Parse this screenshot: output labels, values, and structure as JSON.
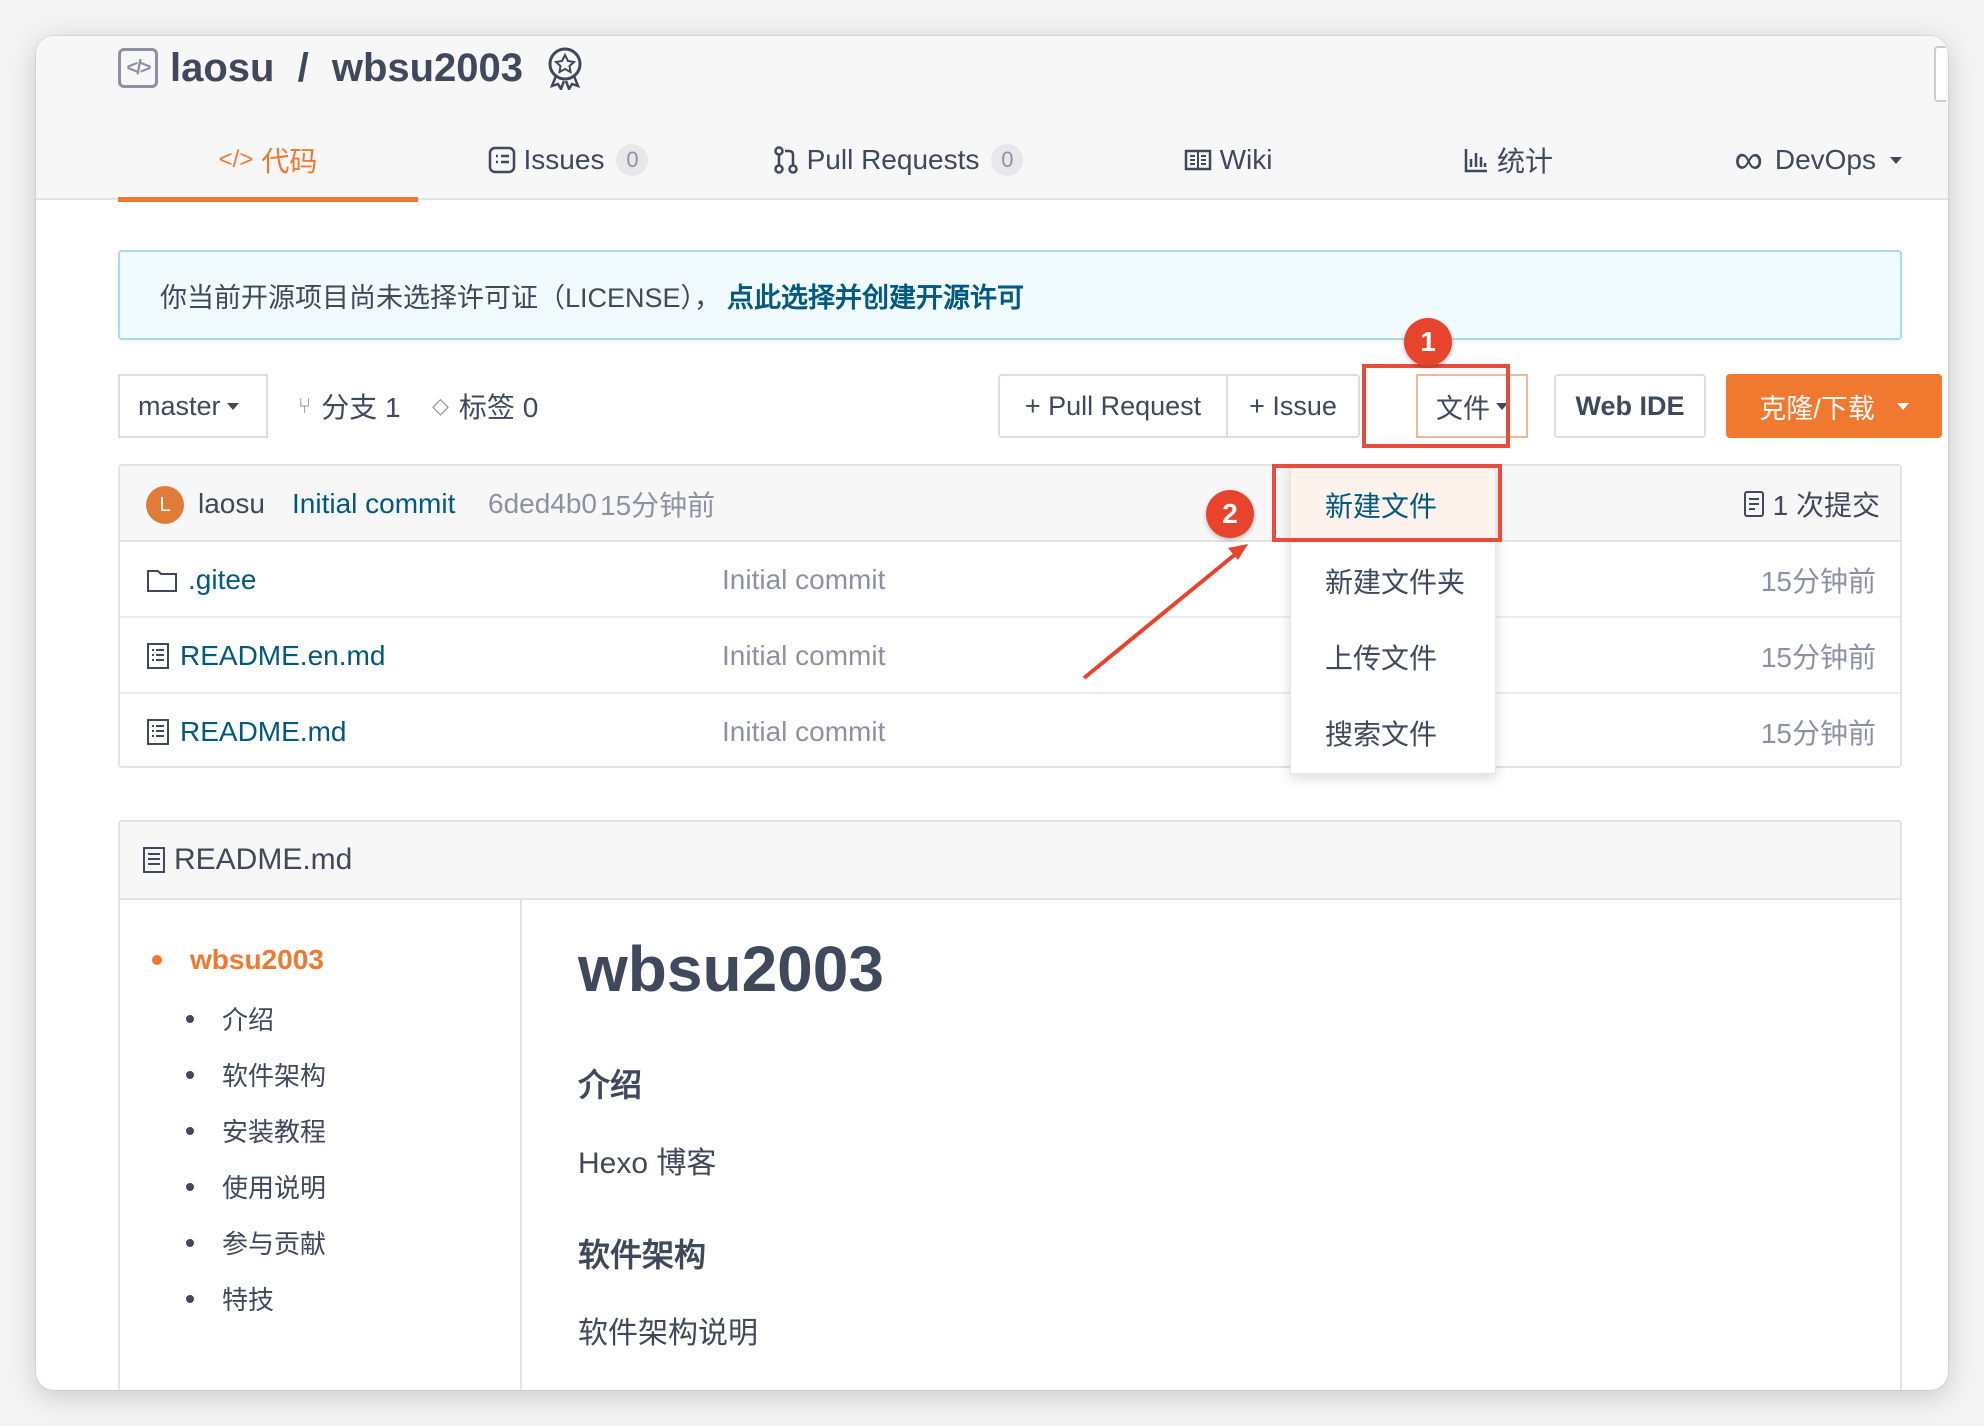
{
  "repo": {
    "owner": "laosu",
    "separator": " / ",
    "name": "wbsu2003"
  },
  "tabs": [
    {
      "label": "代码",
      "icon": "code-icon"
    },
    {
      "label": "Issues",
      "count": "0",
      "icon": "issue-icon"
    },
    {
      "label": "Pull Requests",
      "count": "0",
      "icon": "pull-request-icon"
    },
    {
      "label": "Wiki",
      "icon": "book-icon"
    },
    {
      "label": "统计",
      "icon": "bar-chart-icon"
    },
    {
      "label": "DevOps",
      "icon": "infinity-icon"
    }
  ],
  "notice": {
    "text": "你当前开源项目尚未选择许可证（LICENSE），",
    "link": "点此选择并创建开源许可"
  },
  "toolbar": {
    "branch": "master",
    "branches_label": "分支 1",
    "tags_label": "标签 0",
    "pull_request": "+ Pull Request",
    "issue": "+ Issue",
    "file": "文件",
    "web_ide": "Web IDE",
    "clone": "克隆/下载"
  },
  "commit": {
    "avatar_letter": "L",
    "author": "laosu",
    "message": "Initial commit",
    "hash": "6ded4b0",
    "time": "15分钟前",
    "count_label": "1 次提交"
  },
  "files": [
    {
      "name": ".gitee",
      "type": "folder",
      "message": "Initial commit",
      "time": "15分钟前"
    },
    {
      "name": "README.en.md",
      "type": "file",
      "message": "Initial commit",
      "time": "15分钟前"
    },
    {
      "name": "README.md",
      "type": "file",
      "message": "Initial commit",
      "time": "15分钟前"
    }
  ],
  "file_menu": [
    "新建文件",
    "新建文件夹",
    "上传文件",
    "搜索文件"
  ],
  "annotations": [
    "1",
    "2"
  ],
  "readme": {
    "filename": "README.md",
    "toc_main": "wbsu2003",
    "toc_items": [
      "介绍",
      "软件架构",
      "安装教程",
      "使用说明",
      "参与贡献",
      "特技"
    ],
    "title": "wbsu2003",
    "intro_heading": "介绍",
    "intro_text": "Hexo 博客",
    "arch_heading": "软件架构",
    "arch_text": "软件架构说明"
  },
  "colors": {
    "accent": "#f0782f",
    "link": "#005980",
    "annotation": "#e8432c"
  }
}
